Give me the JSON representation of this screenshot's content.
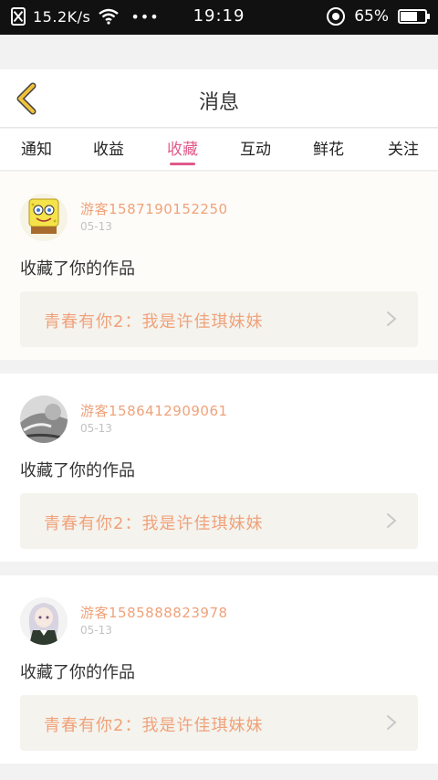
{
  "status_bar": {
    "network_speed": "15.2K/s",
    "more": "•••",
    "time": "19:19",
    "battery_percent": "65%",
    "battery_level": 0.65
  },
  "header": {
    "title": "消息",
    "back_icon": "chevron-left-icon",
    "accent_color": "#f0c23a"
  },
  "tabs": [
    {
      "label": "通知",
      "active": false
    },
    {
      "label": "收益",
      "active": false
    },
    {
      "label": "收藏",
      "active": true
    },
    {
      "label": "互动",
      "active": false
    },
    {
      "label": "鲜花",
      "active": false
    },
    {
      "label": "关注",
      "active": false
    }
  ],
  "colors": {
    "active_tab": "#e05a8a",
    "username": "#f0a27a",
    "work_title": "#f0a27a"
  },
  "messages": [
    {
      "username": "游客1587190152250",
      "date": "05-13",
      "action": "收藏了你的作品",
      "work_title": "青春有你2：我是许佳琪妹妹",
      "avatar": "spongebob-avatar"
    },
    {
      "username": "游客1586412909061",
      "date": "05-13",
      "action": "收藏了你的作品",
      "work_title": "青春有你2：我是许佳琪妹妹",
      "avatar": "grey-photo-avatar"
    },
    {
      "username": "游客1585888823978",
      "date": "05-13",
      "action": "收藏了你的作品",
      "work_title": "青春有你2：我是许佳琪妹妹",
      "avatar": "anime-girl-avatar"
    }
  ]
}
